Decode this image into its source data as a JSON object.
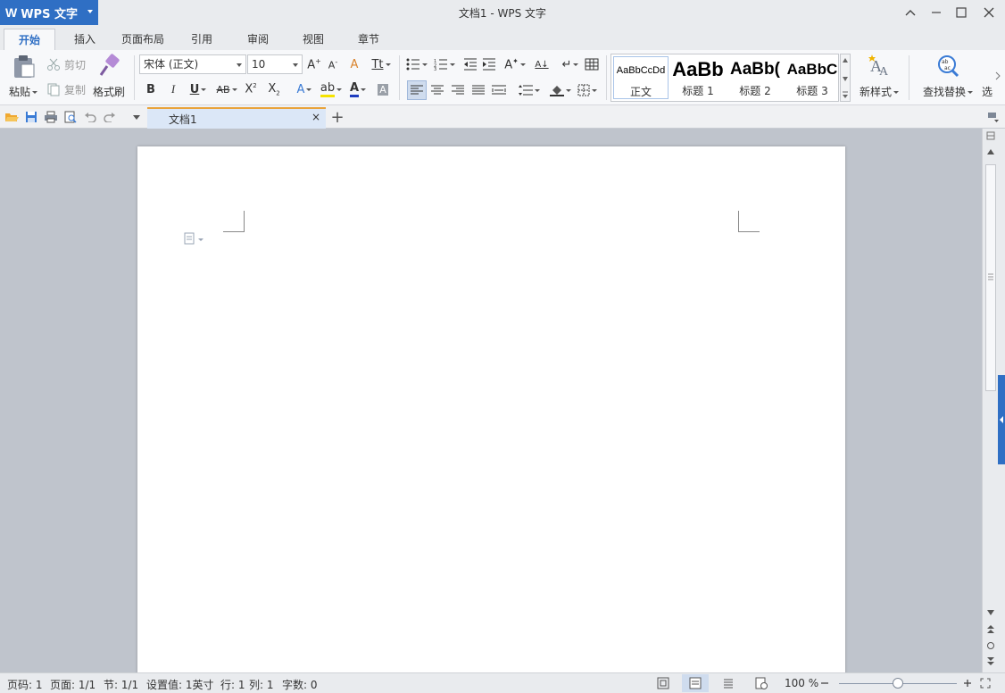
{
  "app": {
    "logo": "W",
    "name": "WPS 文字",
    "window_title": "文档1 - WPS 文字"
  },
  "tabs": [
    "开始",
    "插入",
    "页面布局",
    "引用",
    "审阅",
    "视图",
    "章节"
  ],
  "ribbon": {
    "paste": "粘贴",
    "cut": "剪切",
    "copy": "复制",
    "format_painter": "格式刷",
    "font_name": "宋体 (正文)",
    "font_size": "10",
    "styles": [
      {
        "preview": "AaBbCcDd",
        "label": "正文"
      },
      {
        "preview": "AaBb",
        "label": "标题 1"
      },
      {
        "preview": "AaBb(",
        "label": "标题 2"
      },
      {
        "preview": "AaBbC",
        "label": "标题 3"
      }
    ],
    "new_style": "新样式",
    "find_replace": "查找替换",
    "select": "选"
  },
  "document_tab": {
    "name": "文档1",
    "close": "×",
    "add": "+"
  },
  "status": {
    "page_code": "页码: 1",
    "pages": "页面: 1/1",
    "section": "节: 1/1",
    "setting": "设置值: 1英寸",
    "line": "行: 1",
    "column": "列: 1",
    "word_count": "字数: 0",
    "zoom": "100 %"
  },
  "colors": {
    "accent": "#2f6fc4",
    "tab_highlight": "#e9a33b"
  }
}
